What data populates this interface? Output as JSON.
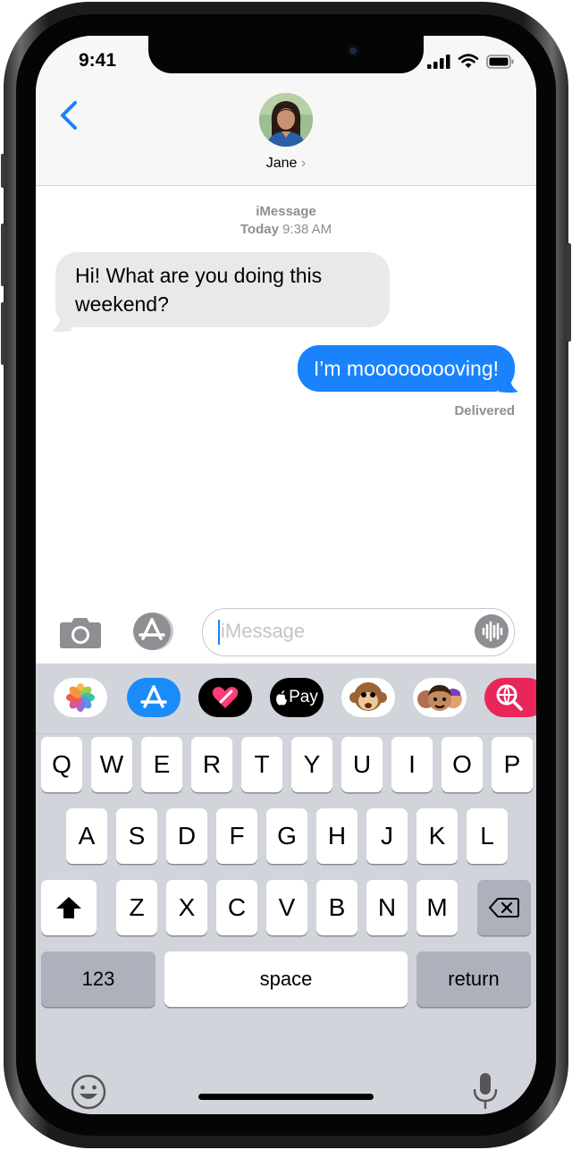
{
  "status_bar": {
    "time": "9:41"
  },
  "header": {
    "contact_name": "Jane",
    "chevron": "›"
  },
  "conversation": {
    "service": "iMessage",
    "day": "Today",
    "time": "9:38 AM",
    "messages": [
      {
        "direction": "incoming",
        "text": "Hi! What are you doing this weekend?"
      },
      {
        "direction": "outgoing",
        "text": "I’m mooooooooving!"
      }
    ],
    "delivery_status": "Delivered"
  },
  "input": {
    "placeholder": "iMessage"
  },
  "app_drawer": [
    {
      "icon": "photos-icon",
      "bg": "#ffffff"
    },
    {
      "icon": "app-store-icon",
      "bg": "#1a8cf9"
    },
    {
      "icon": "digital-touch-icon",
      "bg": "#000000"
    },
    {
      "icon": "apple-pay-icon",
      "bg": "#000000",
      "label": "Pay"
    },
    {
      "icon": "monkey-animoji-icon",
      "bg": "#ffffff"
    },
    {
      "icon": "memoji-stickers-icon",
      "bg": "#ffffff"
    },
    {
      "icon": "gif-search-icon",
      "bg": "#e8265a"
    }
  ],
  "keyboard": {
    "row1": [
      "Q",
      "W",
      "E",
      "R",
      "T",
      "Y",
      "U",
      "I",
      "O",
      "P"
    ],
    "row2": [
      "A",
      "S",
      "D",
      "F",
      "G",
      "H",
      "J",
      "K",
      "L"
    ],
    "row3": [
      "Z",
      "X",
      "C",
      "V",
      "B",
      "N",
      "M"
    ],
    "numbers_label": "123",
    "space_label": "space",
    "return_label": "return"
  },
  "colors": {
    "accent": "#1a82fb",
    "incoming_bubble": "#e9e9eb",
    "keyboard_bg": "#d1d4db"
  }
}
